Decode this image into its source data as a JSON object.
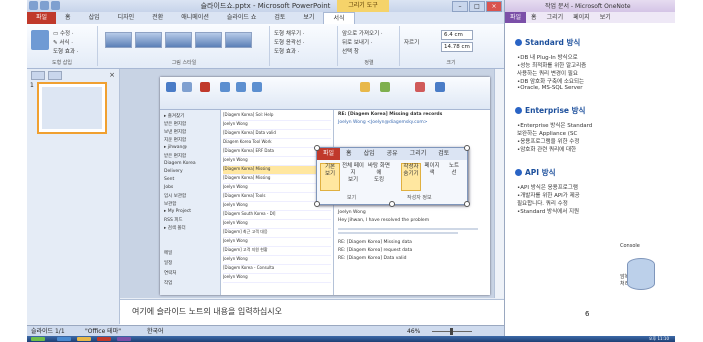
{
  "ppt": {
    "title": "슬라이드쇼.pptx - Microsoft PowerPoint",
    "context_tab": "그리기 도구",
    "tabs": [
      "파일",
      "홈",
      "삽입",
      "디자인",
      "전환",
      "애니메이션",
      "슬라이드 쇼",
      "검토",
      "보기",
      "서식"
    ],
    "ribbon": {
      "insert_shapes_items": [
        "▭ 수정 ·",
        "✎ 서식 ·",
        "도형 효과 ·"
      ],
      "styles_label": "도형 스타일",
      "fill_items": [
        "도형 채우기 ·",
        "도형 윤곽선 ·",
        "도형 효과 ·"
      ],
      "wordart_items": [
        "텍스트 채우기 ·",
        "텍스트 윤곽선 ·",
        "텍스트 효과 ·"
      ],
      "arrange_items": [
        "앞으로 가져오기 ·",
        "뒤로 보내기 ·",
        "선택 창"
      ],
      "crop_label": "자르기",
      "height": "6.4 cm",
      "width": "14.78 cm",
      "group_insert": "도형 삽입",
      "group_styles": "그림 스타일",
      "group_arrange": "정렬",
      "group_size": "크기"
    },
    "slide_number": "1",
    "notes_placeholder": "여기에 슬라이드 노트의 내용을 입력하십시오",
    "status": {
      "slide": "슬라이드 1/1",
      "theme": "\"Office 테마\"",
      "lang": "한국어",
      "zoom": "46%"
    }
  },
  "outlook": {
    "from_subject": "RE: [Diagem Korea] Missing data records",
    "from": "Joelyn Wong <Joelyn@diagemsky.com>",
    "nav_items": [
      "▸ 즐겨찾기",
      "받은 편지함",
      "보낸 편지함",
      "지운 편지함",
      "▸ jihwan@",
      "받은 편지함",
      "Diagem Korea",
      "Delivery",
      "Sent",
      "Jobs",
      "임시 보관함",
      "보관함",
      "▸ My Project",
      "RSS 피드",
      "▸ 검색 폴더",
      "메일",
      "일정",
      "연락처",
      "작업"
    ],
    "rows": [
      "[Diagem Korea] Sol: Help",
      "Joelyn Wong",
      "[Diagem Korea] Data valid",
      "Diagem Korea Tool Work",
      "[Diagem Korea] ERF Data",
      "Joelyn Wong",
      "[Diagem Korea] Missing",
      "[Diagem Korea] Missing",
      "Joelyn Wong",
      "[Diagem Korea] Tools",
      "Joelyn Wong",
      "[Diagem South Korea - DI]",
      "Joelyn Wong",
      "[Diagem] 최근 고객 대응",
      "Joelyn Wong",
      "[Diagem] 고객 지원 현황",
      "Joelyn Wong",
      "[Diagem Korea - Consulta",
      "Joelyn Wong"
    ],
    "read_lines": [
      "Joelyn Wong",
      "Hey Jihwan, I have resolved the problem",
      "RE: [Diagem Korea] Missing data",
      "RE: [Diagem Korea] request data",
      "RE: [Diagem Korea] Data valid"
    ]
  },
  "overlay": {
    "tabs": [
      "파일",
      "홈",
      "삽입",
      "공유",
      "그리기",
      "검토"
    ],
    "buttons": [
      "기본\n보기",
      "전체 페이지\n보기",
      "바탕 화면에\n도킹",
      "작성자\n숨기기",
      "페이지\n색",
      "노트\n선"
    ],
    "group1": "보기",
    "group2": "작성자 정보"
  },
  "onenote": {
    "title": "작업 문서 - Microsoft OneNote",
    "tabs": [
      "파일",
      "홈",
      "그리기",
      "페이지",
      "보기"
    ],
    "sections": [
      {
        "title": "Standard 방식",
        "items": [
          "•DB 내 Plug-In 방식으로",
          "•성능 최적화를 위한 알고리즘",
          "  사용하는 쿼리 변경이 필요",
          "•DB 암호화 구축에 소요되는",
          "•Oracle, MS-SQL Server"
        ]
      },
      {
        "title": "Enterprise 방식",
        "items": [
          "•Enterprise 방식은 Standard",
          "  보완하는 Appliance (SC",
          "•응용프로그램을 위한 수정",
          "•암호화 관련 쿼리에 대한"
        ]
      },
      {
        "title": "API 방식",
        "items": [
          "•API 방식은 응용프로그램",
          "•개발자를 위한 API가 제공",
          "  필요합니다. 쿼리 수정",
          "•Standard 방식에서 지원"
        ]
      }
    ],
    "page_number": "6",
    "caption1": "Console",
    "caption2": "암복호화\n처리"
  },
  "taskbar": {
    "clock": "오후 11:10"
  },
  "colors": {
    "file_tab": "#c0392b",
    "onenote_accent": "#7b4fa8",
    "header_blue": "#1c4f9c"
  }
}
